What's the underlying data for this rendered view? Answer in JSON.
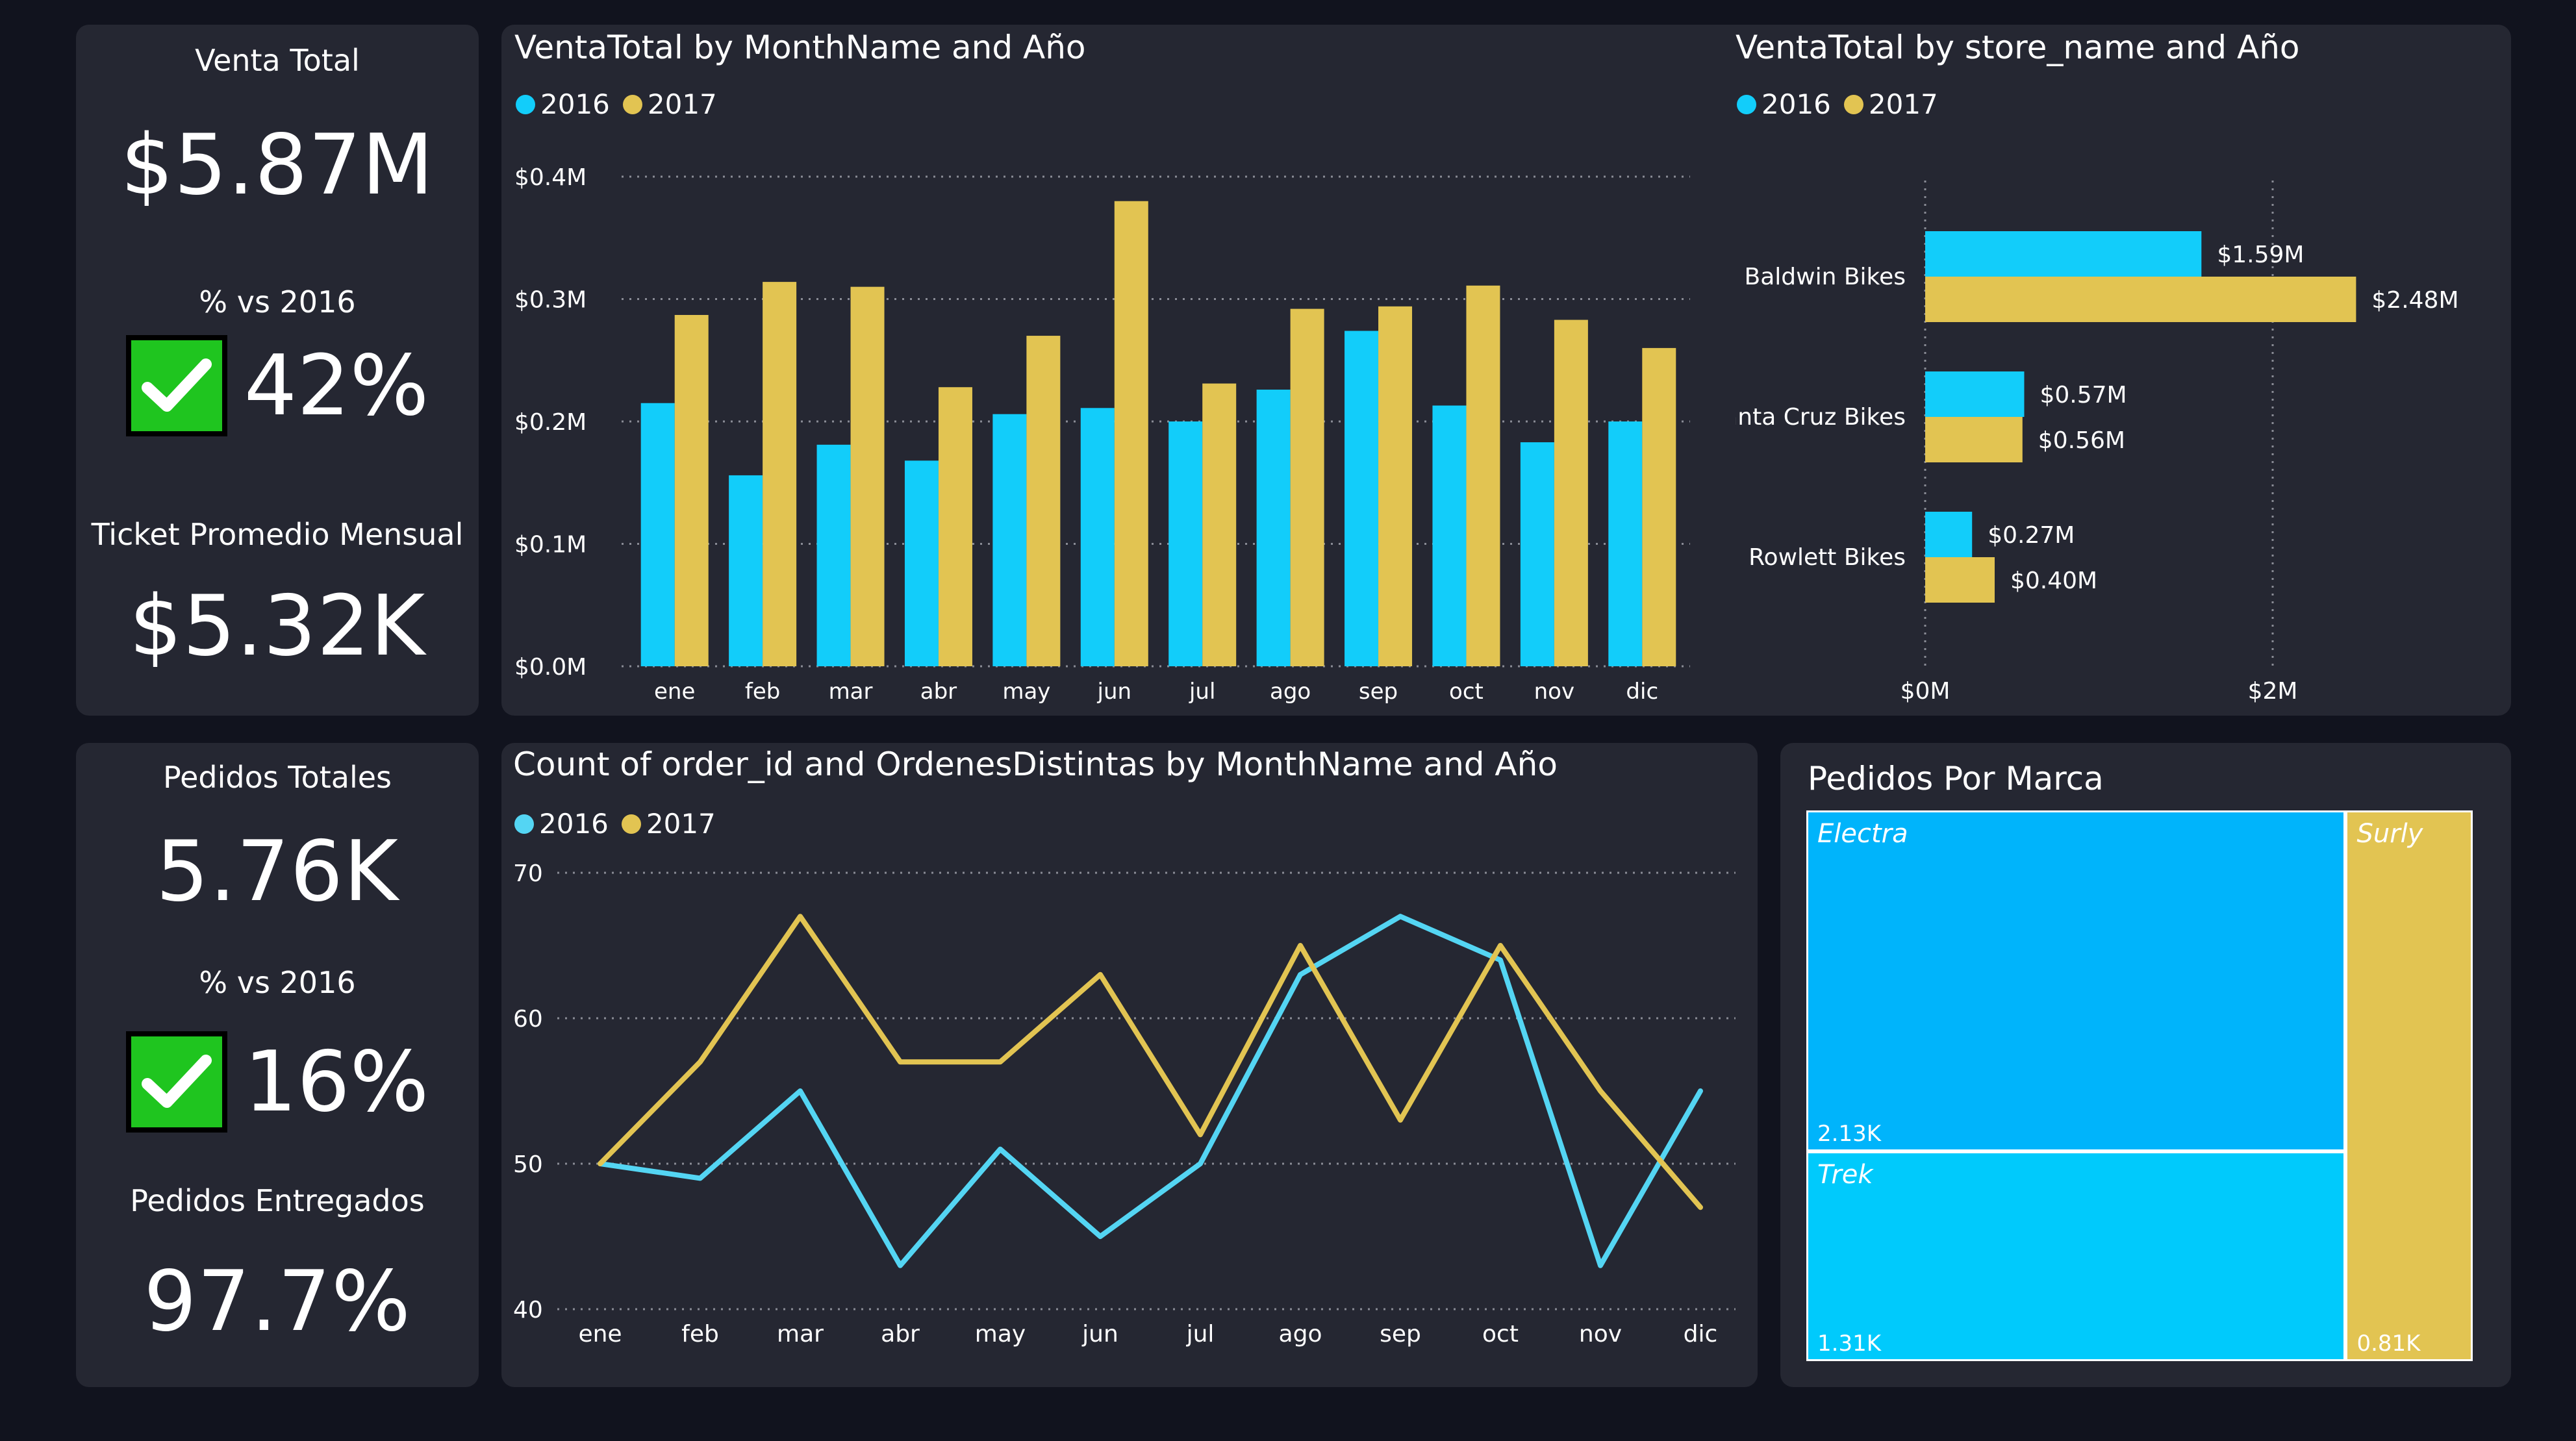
{
  "colors": {
    "y2016": "#12cdfa",
    "y2017": "#e2c452",
    "line2016": "#54d5f3",
    "treemap_electra": "#00b4fb",
    "treemap_trek": "#00cafc",
    "treemap_surly": "#e2c452",
    "check": "#1fc51f"
  },
  "kpi_top": {
    "venta_label": "Venta Total",
    "venta_value": "$5.87M",
    "pct_label": "% vs 2016",
    "pct_value": "42%",
    "ticket_label": "Ticket Promedio Mensual",
    "ticket_value": "$5.32K"
  },
  "kpi_bottom": {
    "pedidos_label": "Pedidos Totales",
    "pedidos_value": "5.76K",
    "pct_label": "% vs 2016",
    "pct_value": "16%",
    "entregados_label": "Pedidos Entregados",
    "entregados_value": "97.7%"
  },
  "legend": {
    "y2016": "2016",
    "y2017": "2017"
  },
  "chart_data": [
    {
      "type": "bar",
      "title": "VentaTotal by MonthName and Año",
      "categories": [
        "ene",
        "feb",
        "mar",
        "abr",
        "may",
        "jun",
        "jul",
        "ago",
        "sep",
        "oct",
        "nov",
        "dic"
      ],
      "series": [
        {
          "name": "2016",
          "values": [
            0.215,
            0.156,
            0.181,
            0.168,
            0.206,
            0.211,
            0.2,
            0.226,
            0.274,
            0.213,
            0.183,
            0.2
          ]
        },
        {
          "name": "2017",
          "values": [
            0.287,
            0.314,
            0.31,
            0.228,
            0.27,
            0.38,
            0.231,
            0.292,
            0.294,
            0.311,
            0.283,
            0.26
          ]
        }
      ],
      "y_ticks": [
        "$0.0M",
        "$0.1M",
        "$0.2M",
        "$0.3M",
        "$0.4M"
      ],
      "ylim": [
        0,
        0.4
      ],
      "grid": true,
      "legend_position": "top-left"
    },
    {
      "type": "bar",
      "orientation": "horizontal",
      "title": "VentaTotal by store_name and Año",
      "categories": [
        "Baldwin Bikes",
        "Santa Cruz Bikes",
        "Rowlett Bikes"
      ],
      "series": [
        {
          "name": "2016",
          "values": [
            1.59,
            0.57,
            0.27
          ],
          "labels": [
            "$1.59M",
            "$0.57M",
            "$0.27M"
          ]
        },
        {
          "name": "2017",
          "values": [
            2.48,
            0.56,
            0.4
          ],
          "labels": [
            "$2.48M",
            "$0.56M",
            "$0.40M"
          ]
        }
      ],
      "x_ticks": [
        "$0M",
        "$2M"
      ],
      "xlim": [
        0,
        2.8
      ],
      "grid": true,
      "legend_position": "top-left"
    },
    {
      "type": "line",
      "title": "Count of order_id and OrdenesDistintas by MonthName and Año",
      "categories": [
        "ene",
        "feb",
        "mar",
        "abr",
        "may",
        "jun",
        "jul",
        "ago",
        "sep",
        "oct",
        "nov",
        "dic"
      ],
      "series": [
        {
          "name": "2016",
          "values": [
            50,
            49,
            55,
            43,
            51,
            45,
            50,
            63,
            67,
            64,
            43,
            55
          ]
        },
        {
          "name": "2017",
          "values": [
            50,
            57,
            67,
            57,
            57,
            63,
            52,
            65,
            53,
            65,
            55,
            47
          ]
        }
      ],
      "y_ticks": [
        "40",
        "50",
        "60",
        "70"
      ],
      "ylim": [
        40,
        70
      ],
      "grid": true,
      "legend_position": "top-left"
    },
    {
      "type": "treemap",
      "title": "Pedidos Por Marca",
      "items": [
        {
          "name": "Electra",
          "label": "2.13K",
          "value": 2130
        },
        {
          "name": "Trek",
          "label": "1.31K",
          "value": 1310
        },
        {
          "name": "Surly",
          "label": "0.81K",
          "value": 810
        }
      ]
    }
  ]
}
